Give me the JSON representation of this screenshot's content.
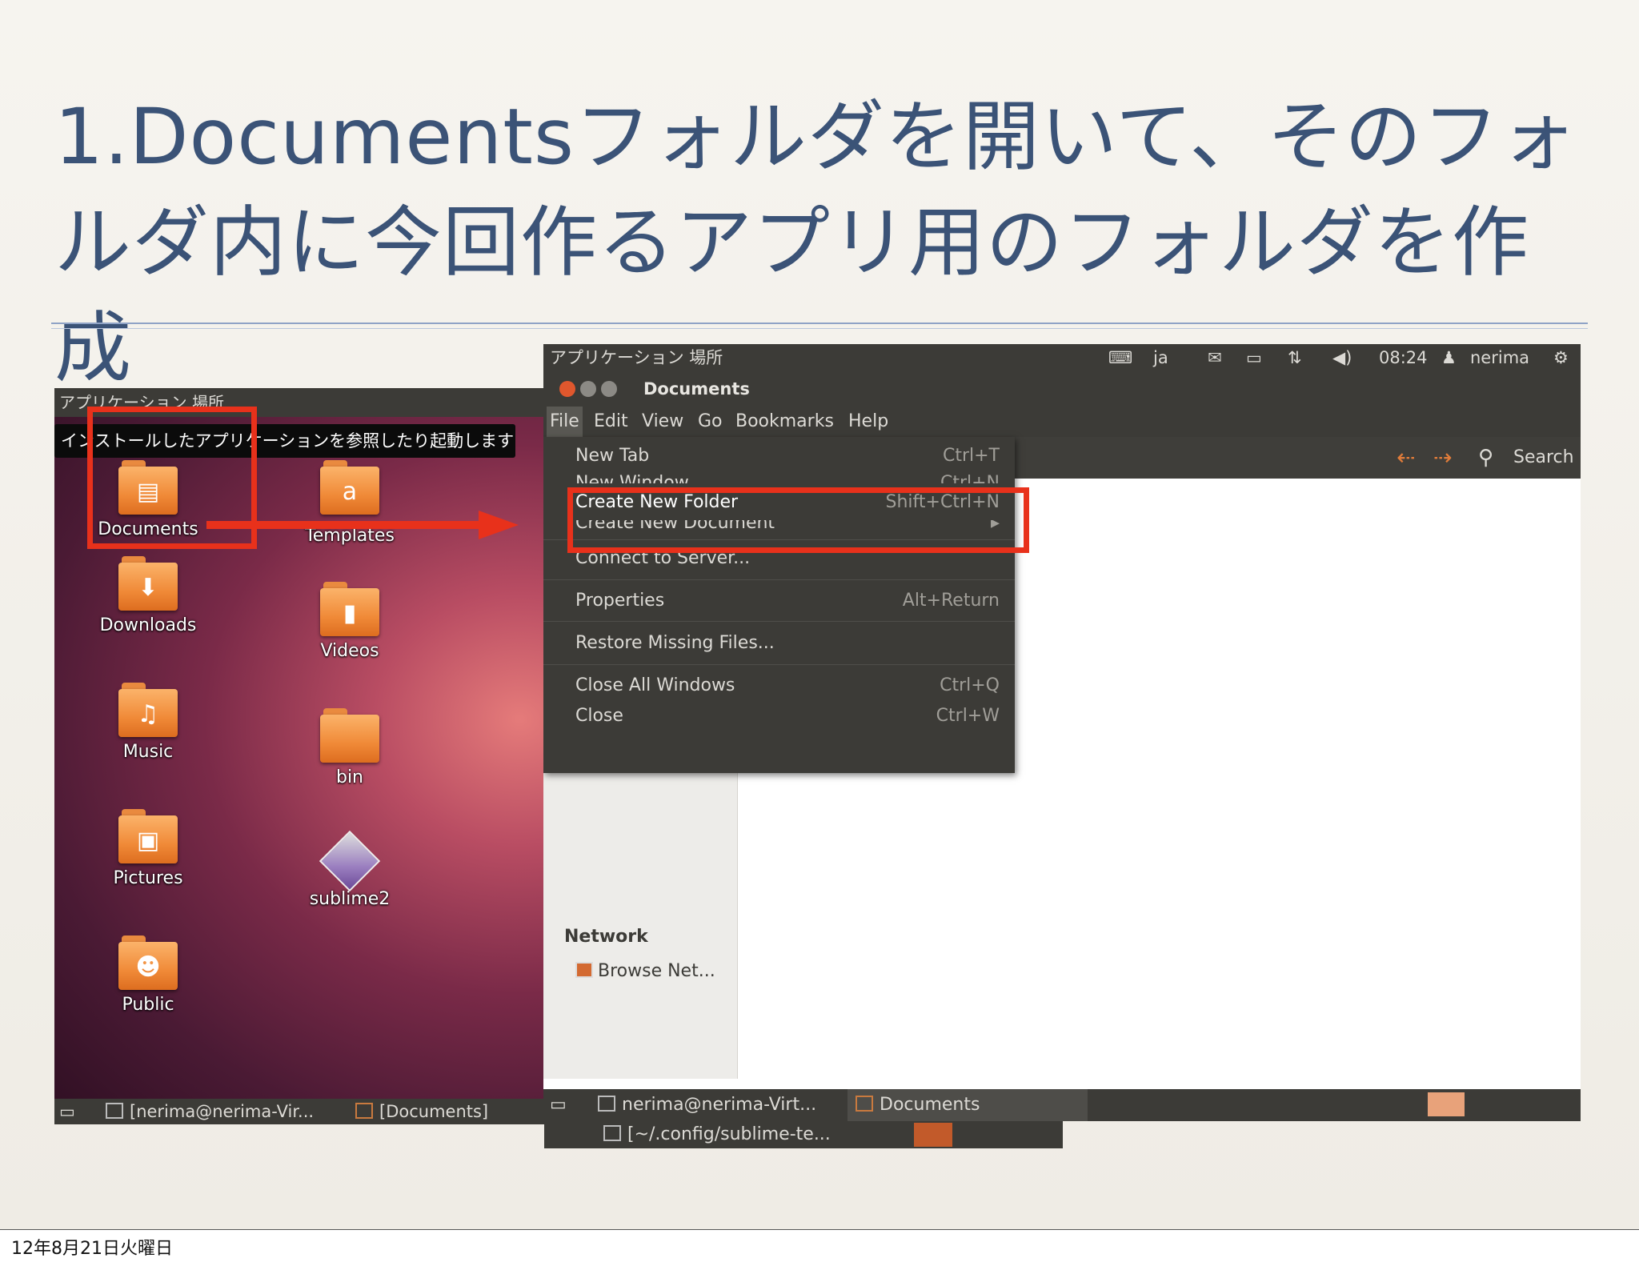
{
  "slide": {
    "title": "1.Documentsフォルダを開いて、そのフォルダ内に今回作るアプリ用のフォルダを作成",
    "footer_date": "12年8月21日火曜日"
  },
  "left_screen": {
    "top_menu": "アプリケーション 場所",
    "tooltip": "インストールしたアプリケーションを参照したり起動します",
    "desktop_icons": [
      {
        "label": "Documents",
        "icon": "documents-folder-icon"
      },
      {
        "label": "Templates",
        "icon": "templates-folder-icon"
      },
      {
        "label": "Downloads",
        "icon": "downloads-folder-icon"
      },
      {
        "label": "Videos",
        "icon": "videos-folder-icon"
      },
      {
        "label": "Music",
        "icon": "music-folder-icon"
      },
      {
        "label": "bin",
        "icon": "folder-icon"
      },
      {
        "label": "Pictures",
        "icon": "pictures-folder-icon"
      },
      {
        "label": "sublime2",
        "icon": "sublime-shortcut-icon"
      },
      {
        "label": "Public",
        "icon": "public-folder-icon"
      }
    ],
    "taskbar": {
      "items": [
        "[nerima@nerima-Vir...",
        "[Documents]",
        "[~/.config/sublime-te..."
      ]
    }
  },
  "right_screen": {
    "top_panel": {
      "menu": "アプリケーション 場所",
      "lang": "ja",
      "time": "08:24",
      "user": "nerima"
    },
    "window_title": "Documents",
    "menubar": [
      "File",
      "Edit",
      "View",
      "Go",
      "Bookmarks",
      "Help"
    ],
    "toolbar": {
      "search_label": "Search"
    },
    "file_menu": [
      {
        "label": "New Tab",
        "shortcut": "Ctrl+T"
      },
      {
        "label": "New Window",
        "shortcut": "Ctrl+N"
      },
      {
        "label": "Create New Folder",
        "shortcut": "Shift+Ctrl+N",
        "highlighted": true
      },
      {
        "label": "Create New Document",
        "shortcut": "▸"
      },
      {
        "label": "Connect to Server...",
        "shortcut": ""
      },
      {
        "label": "Properties",
        "shortcut": "Alt+Return"
      },
      {
        "label": "Restore Missing Files...",
        "shortcut": ""
      },
      {
        "label": "Close All Windows",
        "shortcut": "Ctrl+Q"
      },
      {
        "label": "Close",
        "shortcut": "Ctrl+W"
      }
    ],
    "sidebar": {
      "section": "Network",
      "items": [
        "Browse Net..."
      ]
    },
    "taskbar": {
      "items": [
        "nerima@nerima-Virt...",
        "Documents"
      ]
    }
  },
  "annotation_color": "#e8311b"
}
